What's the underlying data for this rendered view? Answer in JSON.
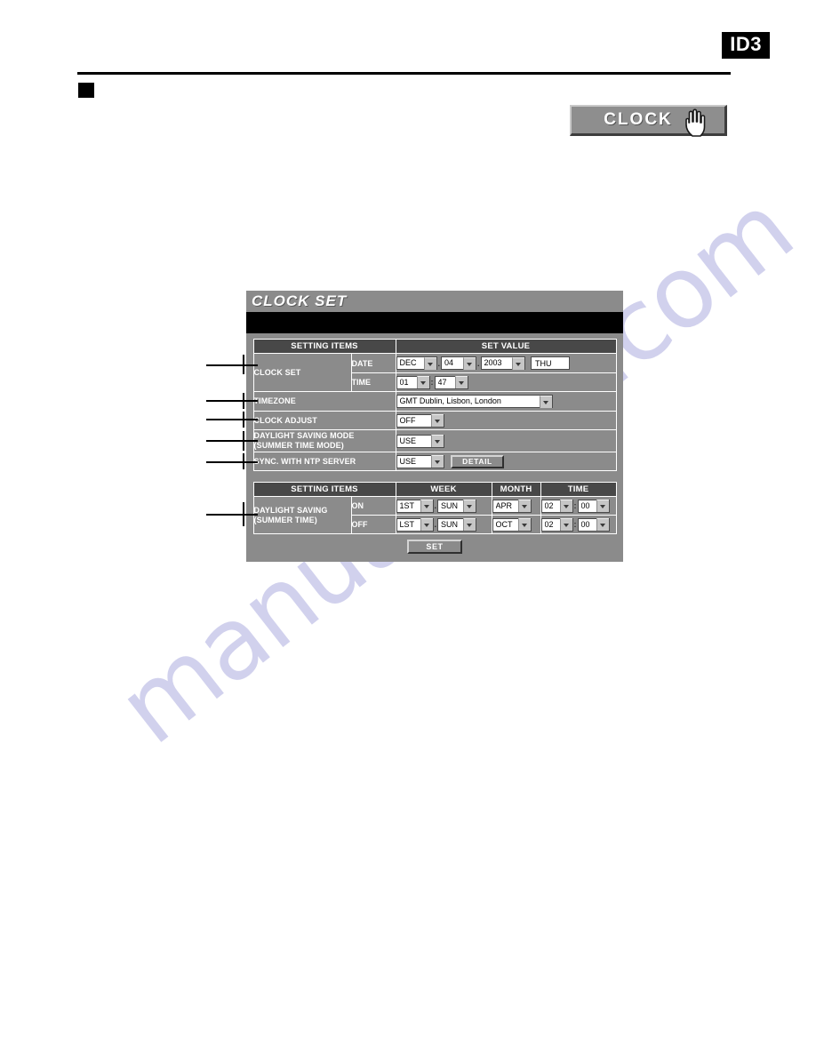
{
  "page": {
    "id_badge": "ID3"
  },
  "toolbar": {
    "clock_tab_label": "CLOCK",
    "cursor_icon": "hand-pointer-icon"
  },
  "panel": {
    "title": "CLOCK SET"
  },
  "table_main": {
    "headers": {
      "setting_items": "SETTING ITEMS",
      "set_value": "SET VALUE"
    },
    "rows": {
      "clock_set": {
        "label": "CLOCK SET",
        "date": {
          "sublabel": "DATE",
          "month": "DEC",
          "day": "04",
          "year": "2003",
          "weekday": "THU",
          "sep1": ".",
          "sep2": "."
        },
        "time": {
          "sublabel": "TIME",
          "hour": "01",
          "minute": "47",
          "sep": ":"
        }
      },
      "timezone": {
        "label": "TIMEZONE",
        "value": "GMT Dublin, Lisbon, London"
      },
      "clock_adjust": {
        "label": "CLOCK ADJUST",
        "value": "OFF"
      },
      "daylight_saving_mode": {
        "label_line1": "DAYLIGHT SAVING MODE",
        "label_line2": "(SUMMER TIME MODE)",
        "value": "USE"
      },
      "sync_ntp": {
        "label": "SYNC. WITH NTP SERVER",
        "value": "USE",
        "detail_button": "DETAIL"
      }
    }
  },
  "table_dst": {
    "headers": {
      "setting_items": "SETTING ITEMS",
      "week": "WEEK",
      "month": "MONTH",
      "time": "TIME"
    },
    "label_line1": "DAYLIGHT SAVING",
    "label_line2": "(SUMMER TIME)",
    "rows": [
      {
        "state": "ON",
        "week_ordinal": "1ST",
        "week_day": "SUN",
        "week_sep": ".",
        "month": "APR",
        "hour": "02",
        "minute": "00",
        "time_sep": ":"
      },
      {
        "state": "OFF",
        "week_ordinal": "LST",
        "week_day": "SUN",
        "week_sep": ".",
        "month": "OCT",
        "hour": "02",
        "minute": "00",
        "time_sep": ":"
      }
    ]
  },
  "actions": {
    "set_button": "SET"
  },
  "watermark": {
    "text": "manualslive.com"
  },
  "colors": {
    "panel_gray": "#8b8b8b",
    "header_gray": "#484848",
    "black": "#000000",
    "white": "#ffffff",
    "watermark": "#c9c9ea"
  }
}
